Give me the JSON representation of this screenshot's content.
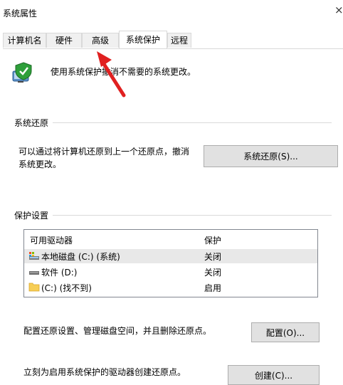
{
  "window": {
    "title": "系统属性",
    "close_glyph": "×"
  },
  "tabs": [
    {
      "label": "计算机名",
      "active": false
    },
    {
      "label": "硬件",
      "active": false
    },
    {
      "label": "高级",
      "active": false
    },
    {
      "label": "系统保护",
      "active": true
    },
    {
      "label": "远程",
      "active": false
    }
  ],
  "intro": {
    "text": "使用系统保护撤消不需要的系统更改。",
    "icon": "system-protection-shield-icon"
  },
  "restore": {
    "group_title": "系统还原",
    "description": "可以通过将计算机还原到上一个还原点，撤消\n系统更改。",
    "button_label": "系统还原(S)..."
  },
  "protection": {
    "group_title": "保护设置",
    "columns": [
      "可用驱动器",
      "保护"
    ],
    "drives": [
      {
        "name": "本地磁盘 (C:) (系统)",
        "protection": "关闭",
        "icon": "system-drive-icon",
        "selected": true
      },
      {
        "name": "软件 (D:)",
        "protection": "关闭",
        "icon": "drive-icon",
        "selected": false
      },
      {
        "name": "(C:) (找不到)",
        "protection": "启用",
        "icon": "folder-icon",
        "selected": false
      }
    ],
    "configure_text": "配置还原设置、管理磁盘空间，并且删除还原点。",
    "configure_button": "配置(O)...",
    "create_text": "立刻为启用系统保护的驱动器创建还原点。",
    "create_button": "创建(C)..."
  },
  "annotation": {
    "icon": "red-arrow-icon",
    "color": "#e02020"
  }
}
